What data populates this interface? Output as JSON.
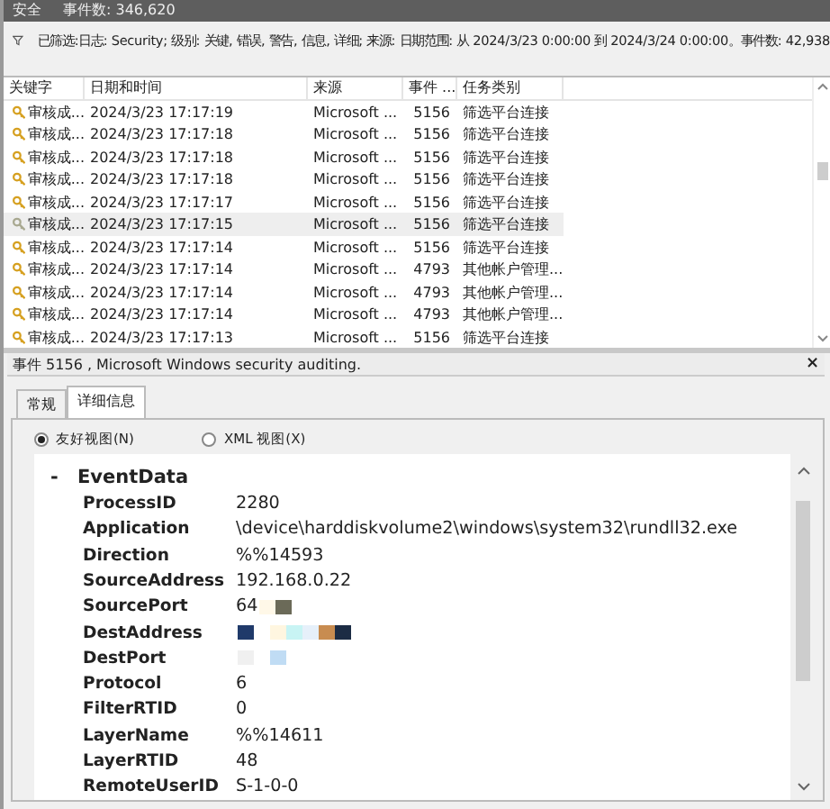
{
  "title_bar": {
    "log": "安全",
    "count": "事件数: 346,620"
  },
  "filter": "已筛选:日志: Security; 级别: 关键, 错误, 警告, 信息, 详细; 来源: 日期范围: 从 2024/3/23 0:00:00 到 2024/3/24 0:00:00。事件数: 42,938",
  "table": {
    "columns": [
      "关键字",
      "日期和时间",
      "来源",
      "事件 ...",
      "任务类别"
    ],
    "rows": [
      {
        "keyword": "审核成...",
        "date": "2024/3/23 17:17:19",
        "source": "Microsoft ...",
        "event_id": "5156",
        "task": "筛选平台连接",
        "selected": false
      },
      {
        "keyword": "审核成...",
        "date": "2024/3/23 17:17:18",
        "source": "Microsoft ...",
        "event_id": "5156",
        "task": "筛选平台连接",
        "selected": false
      },
      {
        "keyword": "审核成...",
        "date": "2024/3/23 17:17:18",
        "source": "Microsoft ...",
        "event_id": "5156",
        "task": "筛选平台连接",
        "selected": false
      },
      {
        "keyword": "审核成...",
        "date": "2024/3/23 17:17:18",
        "source": "Microsoft ...",
        "event_id": "5156",
        "task": "筛选平台连接",
        "selected": false
      },
      {
        "keyword": "审核成...",
        "date": "2024/3/23 17:17:17",
        "source": "Microsoft ...",
        "event_id": "5156",
        "task": "筛选平台连接",
        "selected": false
      },
      {
        "keyword": "审核成...",
        "date": "2024/3/23 17:17:15",
        "source": "Microsoft ...",
        "event_id": "5156",
        "task": "筛选平台连接",
        "selected": true
      },
      {
        "keyword": "审核成...",
        "date": "2024/3/23 17:17:14",
        "source": "Microsoft ...",
        "event_id": "5156",
        "task": "筛选平台连接",
        "selected": false
      },
      {
        "keyword": "审核成...",
        "date": "2024/3/23 17:17:14",
        "source": "Microsoft ...",
        "event_id": "4793",
        "task": "其他帐户管理...",
        "selected": false
      },
      {
        "keyword": "审核成...",
        "date": "2024/3/23 17:17:14",
        "source": "Microsoft ...",
        "event_id": "4793",
        "task": "其他帐户管理...",
        "selected": false
      },
      {
        "keyword": "审核成...",
        "date": "2024/3/23 17:17:14",
        "source": "Microsoft ...",
        "event_id": "4793",
        "task": "其他帐户管理...",
        "selected": false
      },
      {
        "keyword": "审核成...",
        "date": "2024/3/23 17:17:13",
        "source": "Microsoft ...",
        "event_id": "5156",
        "task": "筛选平台连接",
        "selected": false
      }
    ]
  },
  "detail": {
    "title": "事件 5156 , Microsoft Windows security auditing.",
    "close": "×",
    "tabs": [
      {
        "label": "常规",
        "selected": false
      },
      {
        "label": "详细信息",
        "selected": true
      }
    ],
    "views": [
      {
        "label": "友好视图(N)",
        "selected": true
      },
      {
        "label": "XML 视图(X)",
        "selected": false
      }
    ],
    "section": {
      "toggle": "-",
      "label": "EventData",
      "fields": [
        {
          "name": "ProcessID",
          "value": "2280",
          "redacted": false
        },
        {
          "name": "Application",
          "value": "\\device\\harddiskvolume2\\windows\\system32\\rundll32.exe",
          "redacted": false
        },
        {
          "name": "Direction",
          "value": "%%14593",
          "redacted": false
        },
        {
          "name": "SourceAddress",
          "value": "192.168.0.22",
          "redacted": false
        },
        {
          "name": "SourcePort",
          "value": "64",
          "redacted": true
        },
        {
          "name": "DestAddress",
          "redacted": true
        },
        {
          "name": "DestPort",
          "redacted": true
        },
        {
          "name": "Protocol",
          "value": "6",
          "redacted": false
        },
        {
          "name": "FilterRTID",
          "value": "0",
          "redacted": false
        },
        {
          "name": "LayerName",
          "value": "%%14611",
          "redacted": false
        },
        {
          "name": "LayerRTID",
          "value": "48",
          "redacted": false
        },
        {
          "name": "RemoteUserID",
          "value": "S-1-0-0",
          "redacted": false
        }
      ]
    }
  }
}
